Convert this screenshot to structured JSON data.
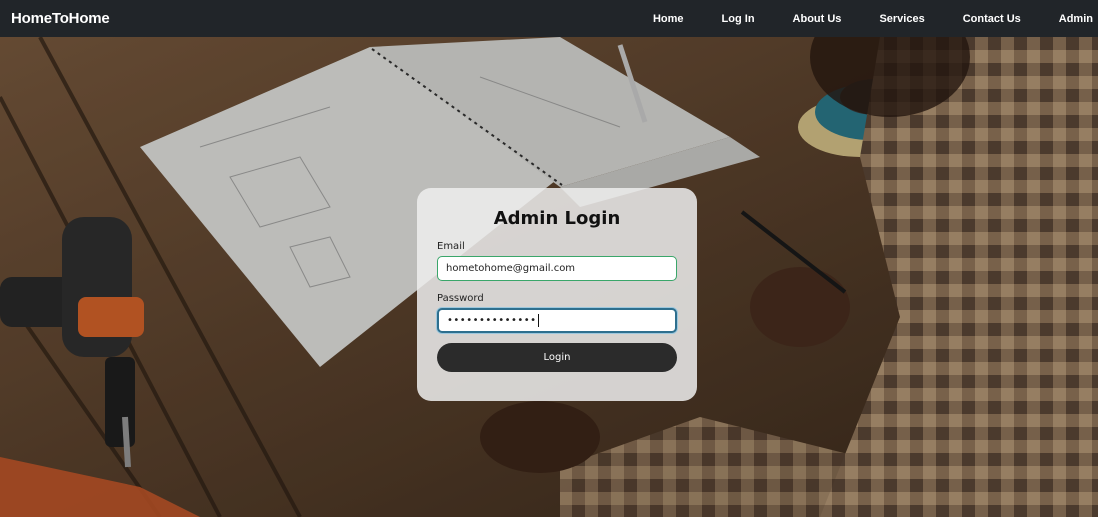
{
  "navbar": {
    "brand": "HomeToHome",
    "links": [
      "Home",
      "Log In",
      "About Us",
      "Services",
      "Contact Us",
      "Admin"
    ]
  },
  "login": {
    "title": "Admin Login",
    "email_label": "Email",
    "email_value": "hometohome@gmail.com",
    "password_label": "Password",
    "password_masked": "••••••••••••••",
    "button_label": "Login"
  },
  "colors": {
    "navbar_bg": "#212529",
    "button_bg": "#2b2b2b",
    "email_border": "#3aa66a",
    "password_border": "#2e6f8e"
  },
  "icons": [
    "power-drill",
    "pencil",
    "pen",
    "sketchbook",
    "sander"
  ]
}
